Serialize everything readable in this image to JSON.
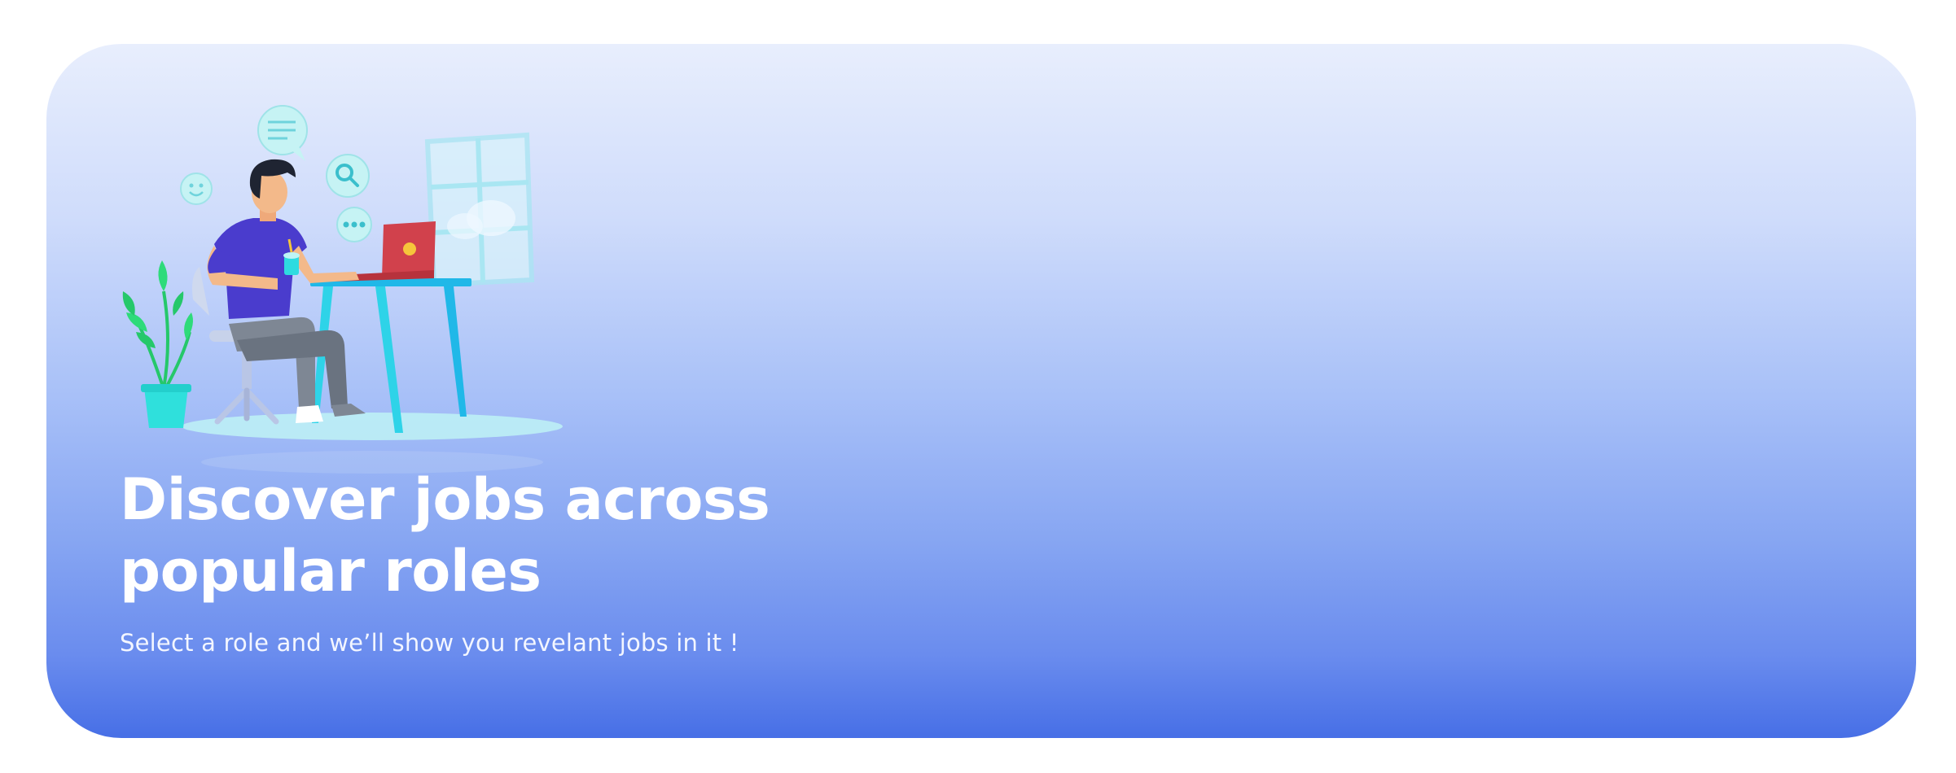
{
  "banner": {
    "title_line1": "Discover jobs across",
    "title_line2": "popular roles",
    "subtitle": "Select a role and we’ll show you revelant jobs in it !",
    "illustration": "person-working-at-laptop-illustration",
    "colors": {
      "gradient_top": "#e8eefd",
      "gradient_bottom": "#476fe6",
      "text": "#ffffff"
    }
  }
}
